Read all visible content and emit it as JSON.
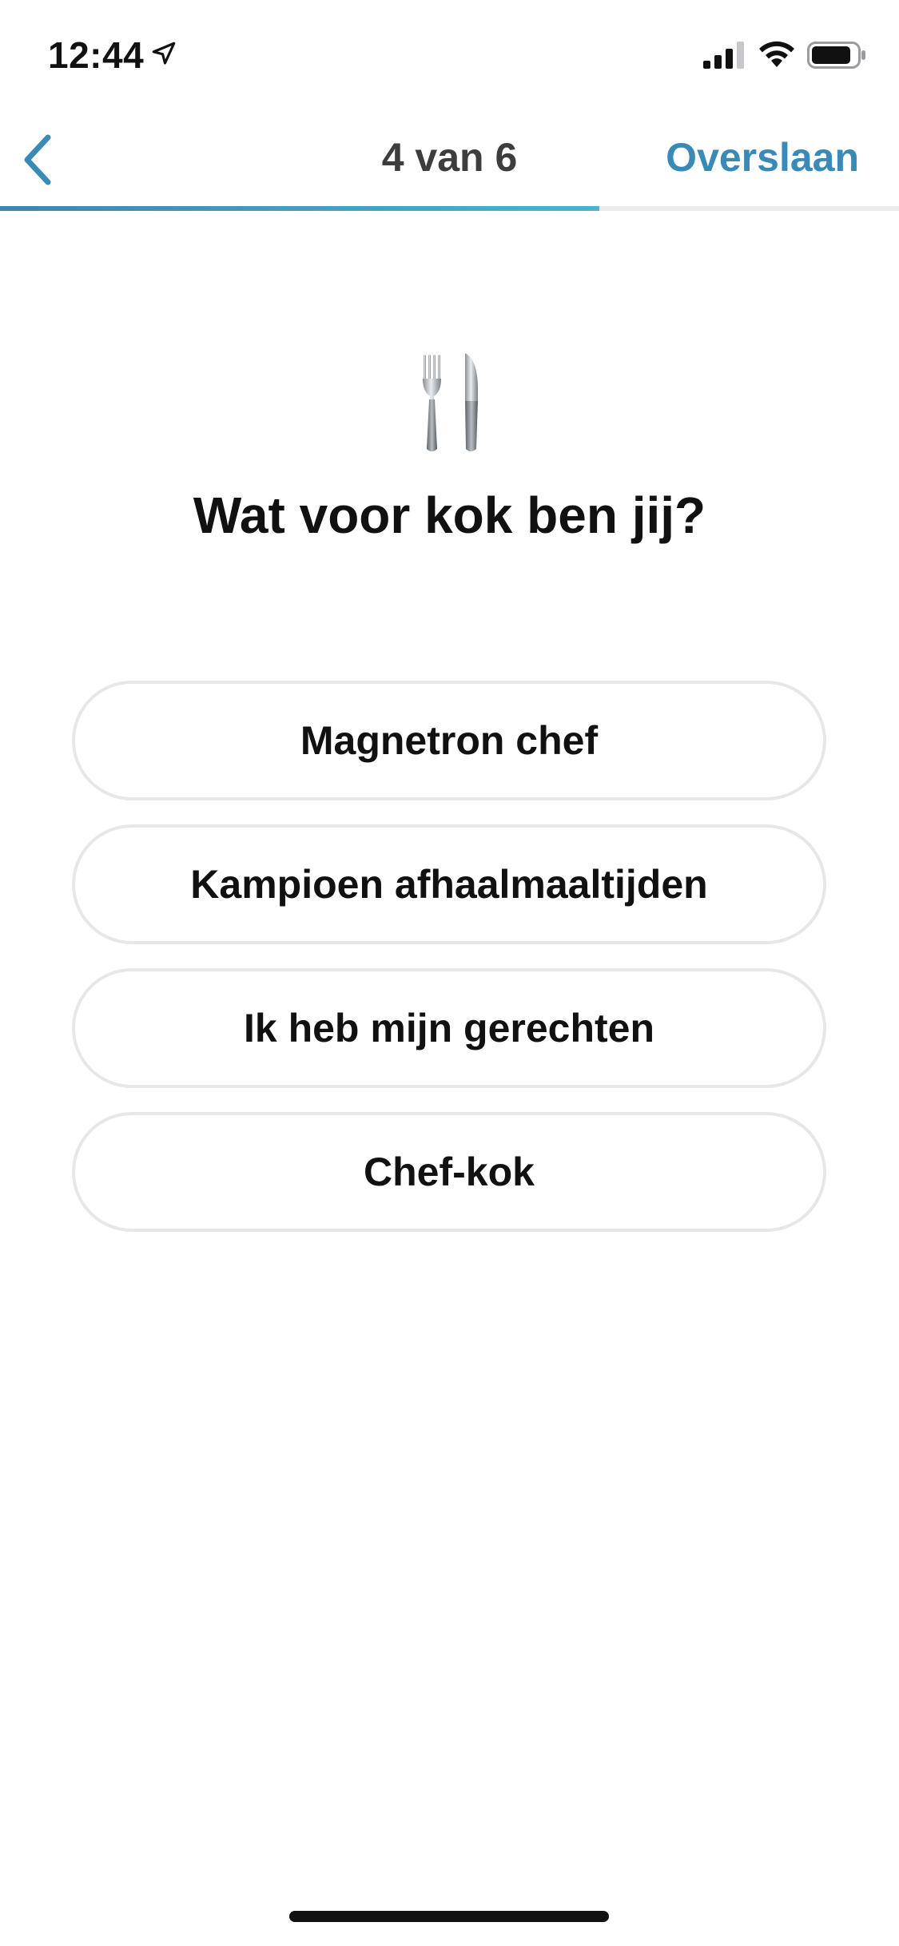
{
  "status_bar": {
    "time": "12:44",
    "location_icon": "location-arrow-icon",
    "signal_icon": "cellular-signal-icon",
    "wifi_icon": "wifi-icon",
    "battery_icon": "battery-icon"
  },
  "nav": {
    "back_icon": "chevron-left-icon",
    "title": "4 van 6",
    "skip_label": "Overslaan"
  },
  "progress": {
    "step": 4,
    "total": 6,
    "fraction": 0.667
  },
  "question": {
    "icon": "fork-and-knife-icon",
    "title": "Wat voor kok ben jij?"
  },
  "options": [
    {
      "label": "Magnetron chef"
    },
    {
      "label": "Kampioen afhaalmaaltijden"
    },
    {
      "label": "Ik heb mijn gerechten"
    },
    {
      "label": "Chef-kok"
    }
  ],
  "colors": {
    "accent": "#3a8ab8",
    "progress_start": "#3a86b4",
    "progress_end": "#4fb1cf",
    "option_border": "#e7e7ea",
    "text": "#111111"
  }
}
